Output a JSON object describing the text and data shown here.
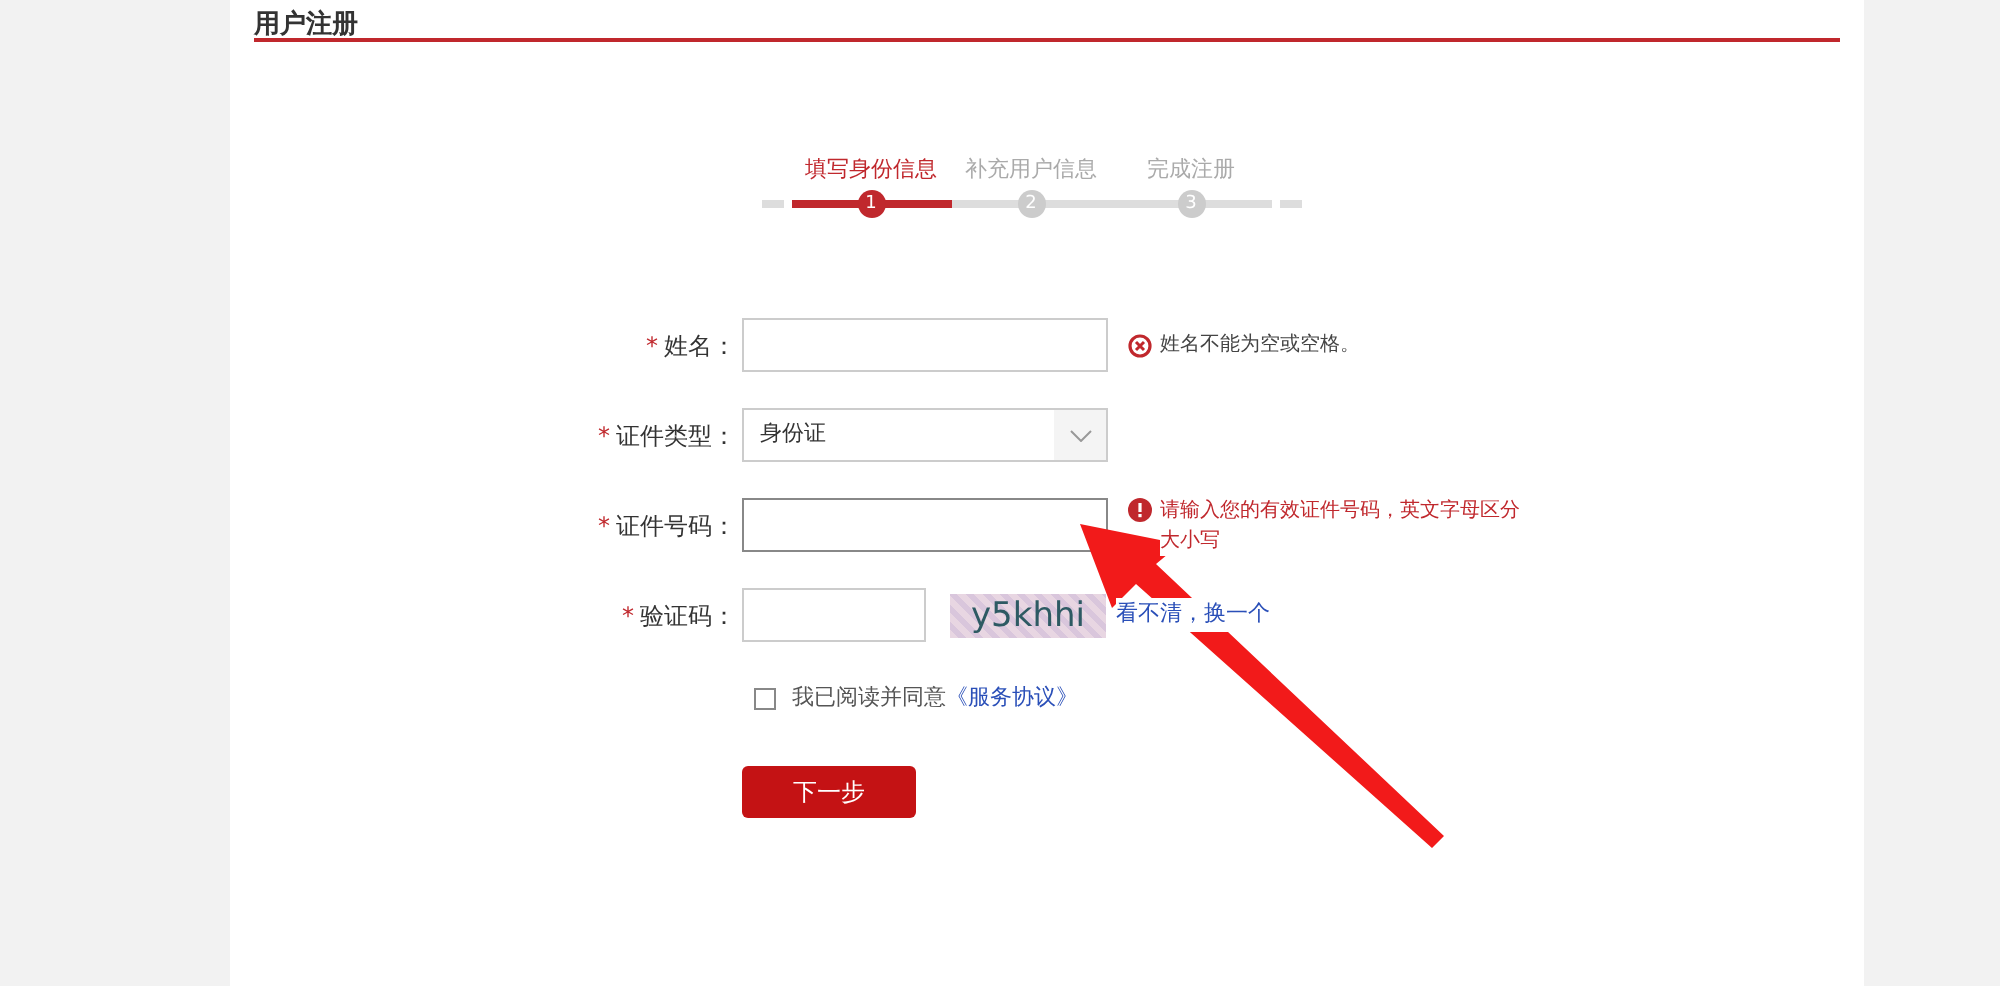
{
  "title": "用户注册",
  "steps": [
    {
      "number": "1",
      "label": "填写身份信息",
      "selected": true
    },
    {
      "number": "2",
      "label": "补充用户信息",
      "selected": false
    },
    {
      "number": "3",
      "label": "完成注册",
      "selected": false
    }
  ],
  "fields": [
    {
      "kind": "text",
      "required_mark": "*",
      "label": "姓名：",
      "focused": false,
      "message": {
        "kind": "error",
        "text": "姓名不能为空或空格。"
      }
    },
    {
      "kind": "select",
      "required_mark": "*",
      "label": "证件类型：",
      "value": "身份证"
    },
    {
      "kind": "text",
      "required_mark": "*",
      "label": "证件号码：",
      "focused": true,
      "message": {
        "kind": "warning",
        "text": "请输入您的有效证件号码，英文字母区分大小写"
      }
    },
    {
      "kind": "captcha",
      "required_mark": "*",
      "label": "验证码：",
      "focused": false,
      "captcha": "y5khhi",
      "refresh_link": "看不清，换一个"
    }
  ],
  "agreement": {
    "checked": false,
    "text": "我已阅读并同意",
    "link": "《服务协议》"
  },
  "submit": "下一步"
}
